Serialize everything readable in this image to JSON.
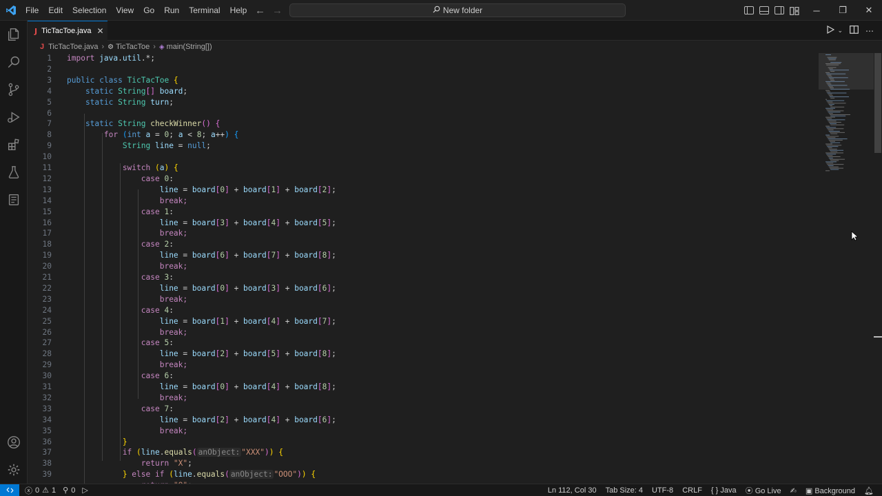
{
  "titlebar": {
    "menu": [
      "File",
      "Edit",
      "Selection",
      "View",
      "Go",
      "Run",
      "Terminal",
      "Help"
    ],
    "search_text": "New folder"
  },
  "tab": {
    "label": "TicTacToe.java",
    "icon": "J"
  },
  "breadcrumb": {
    "file": "TicTacToe.java",
    "class": "TicTacToe",
    "method": "main(String[])"
  },
  "code_lines": [
    {
      "n": "1"
    },
    {
      "n": "2"
    },
    {
      "n": "3"
    },
    {
      "n": "4"
    },
    {
      "n": "5"
    },
    {
      "n": "6"
    },
    {
      "n": "7"
    },
    {
      "n": "8"
    },
    {
      "n": "9"
    },
    {
      "n": "10"
    },
    {
      "n": "11"
    },
    {
      "n": "12"
    },
    {
      "n": "13"
    },
    {
      "n": "14"
    },
    {
      "n": "15"
    },
    {
      "n": "16"
    },
    {
      "n": "17"
    },
    {
      "n": "18"
    },
    {
      "n": "19"
    },
    {
      "n": "20"
    },
    {
      "n": "21"
    },
    {
      "n": "22"
    },
    {
      "n": "23"
    },
    {
      "n": "24"
    },
    {
      "n": "25"
    },
    {
      "n": "26"
    },
    {
      "n": "27"
    },
    {
      "n": "28"
    },
    {
      "n": "29"
    },
    {
      "n": "30"
    },
    {
      "n": "31"
    },
    {
      "n": "32"
    },
    {
      "n": "33"
    },
    {
      "n": "34"
    },
    {
      "n": "35"
    },
    {
      "n": "36"
    },
    {
      "n": "37"
    },
    {
      "n": "38"
    },
    {
      "n": "39"
    }
  ],
  "code": {
    "l1": [
      [
        "kw2",
        "import "
      ],
      [
        "vr",
        "java"
      ],
      [
        "pn",
        "."
      ],
      [
        "vr",
        "util"
      ],
      [
        "pn",
        ".*;"
      ]
    ],
    "l3": [
      [
        "kw",
        "public class "
      ],
      [
        "ty",
        "TicTacToe "
      ],
      [
        "br1",
        "{"
      ]
    ],
    "l4": [
      [
        "kw",
        "    static "
      ],
      [
        "ty",
        "String"
      ],
      [
        "br2",
        "[]"
      ],
      [
        "vr",
        " board"
      ],
      [
        "pn",
        ";"
      ]
    ],
    "l5": [
      [
        "kw",
        "    static "
      ],
      [
        "ty",
        "String "
      ],
      [
        "vr",
        "turn"
      ],
      [
        "pn",
        ";"
      ]
    ],
    "l7": [
      [
        "kw",
        "    static "
      ],
      [
        "ty",
        "String "
      ],
      [
        "fn",
        "checkWinner"
      ],
      [
        "br2",
        "()"
      ],
      [
        "pn",
        " "
      ],
      [
        "br2",
        "{"
      ]
    ],
    "l8": [
      [
        "kw2",
        "        for "
      ],
      [
        "br3",
        "("
      ],
      [
        "kw",
        "int "
      ],
      [
        "vr",
        "a"
      ],
      [
        "pn",
        " = "
      ],
      [
        "nm",
        "0"
      ],
      [
        "pn",
        "; "
      ],
      [
        "vr",
        "a"
      ],
      [
        "pn",
        " < "
      ],
      [
        "nm",
        "8"
      ],
      [
        "pn",
        "; "
      ],
      [
        "vr",
        "a"
      ],
      [
        "pn",
        "++"
      ],
      [
        "br3",
        ")"
      ],
      [
        "pn",
        " "
      ],
      [
        "br3",
        "{"
      ]
    ],
    "l9": [
      [
        "ty",
        "            String "
      ],
      [
        "vr",
        "line"
      ],
      [
        "pn",
        " = "
      ],
      [
        "kw",
        "null"
      ],
      [
        "pn",
        ";"
      ]
    ],
    "l11": [
      [
        "kw2",
        "            switch "
      ],
      [
        "br1",
        "("
      ],
      [
        "vr",
        "a"
      ],
      [
        "br1",
        ")"
      ],
      [
        "pn",
        " "
      ],
      [
        "br1",
        "{"
      ]
    ],
    "case_label": "case",
    "break_label": "break;",
    "cases": [
      {
        "c": "0",
        "a": "0",
        "b": "1",
        "d": "2"
      },
      {
        "c": "1",
        "a": "3",
        "b": "4",
        "d": "5"
      },
      {
        "c": "2",
        "a": "6",
        "b": "7",
        "d": "8"
      },
      {
        "c": "3",
        "a": "0",
        "b": "3",
        "d": "6"
      },
      {
        "c": "4",
        "a": "1",
        "b": "4",
        "d": "7"
      },
      {
        "c": "5",
        "a": "2",
        "b": "5",
        "d": "8"
      },
      {
        "c": "6",
        "a": "0",
        "b": "4",
        "d": "8"
      },
      {
        "c": "7",
        "a": "2",
        "b": "4",
        "d": "6"
      }
    ],
    "l36": [
      [
        "br1",
        "            }"
      ]
    ],
    "l37": [
      [
        "kw2",
        "            if "
      ],
      [
        "br1",
        "("
      ],
      [
        "vr",
        "line"
      ],
      [
        "pn",
        "."
      ],
      [
        "fn",
        "equals"
      ],
      [
        "br2",
        "("
      ],
      [
        "hint",
        "anObject:"
      ],
      [
        "st",
        "\"XXX\""
      ],
      [
        "br2",
        ")"
      ],
      [
        "br1",
        ")"
      ],
      [
        "pn",
        " "
      ],
      [
        "br1",
        "{"
      ]
    ],
    "l38": [
      [
        "kw2",
        "                return "
      ],
      [
        "st",
        "\"X\""
      ],
      [
        "pn",
        ";"
      ]
    ],
    "l39": [
      [
        "br1",
        "            }"
      ],
      [
        "kw2",
        " else if "
      ],
      [
        "br1",
        "("
      ],
      [
        "vr",
        "line"
      ],
      [
        "pn",
        "."
      ],
      [
        "fn",
        "equals"
      ],
      [
        "br2",
        "("
      ],
      [
        "hint",
        "anObject:"
      ],
      [
        "st",
        "\"OOO\""
      ],
      [
        "br2",
        ")"
      ],
      [
        "br1",
        ")"
      ],
      [
        "pn",
        " "
      ],
      [
        "br1",
        "{"
      ]
    ],
    "l40": [
      [
        "kw2",
        "                return "
      ],
      [
        "st",
        "\"O\""
      ],
      [
        "pn",
        ";"
      ]
    ]
  },
  "statusbar": {
    "errors": "0",
    "warnings": "1",
    "ports": "0",
    "position": "Ln 112, Col 30",
    "tab_size": "Tab Size: 4",
    "encoding": "UTF-8",
    "eol": "CRLF",
    "language": "Java",
    "golive": "Go Live",
    "background": "Background"
  },
  "colors": {
    "accent": "#0078d4",
    "background": "#1f1f1f"
  }
}
